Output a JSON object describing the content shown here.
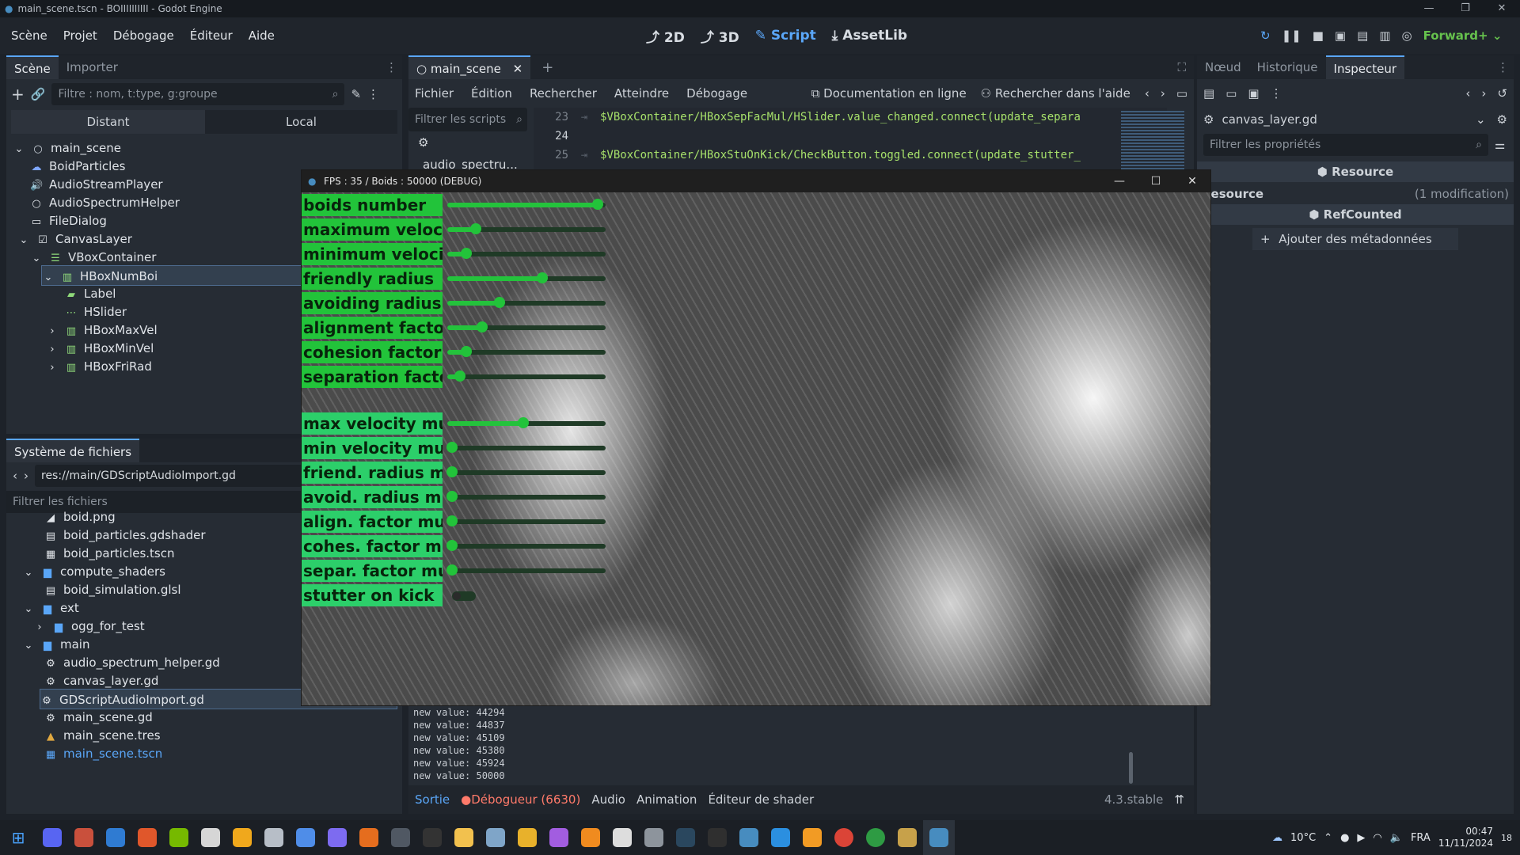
{
  "window": {
    "title": "main_scene.tscn - BOIIIIIIIIII - Godot Engine"
  },
  "menubar": {
    "items": [
      "Scène",
      "Projet",
      "Débogage",
      "Éditeur",
      "Aide"
    ],
    "main_tabs": [
      "2D",
      "3D",
      "Script",
      "AssetLib"
    ],
    "renderer": "Forward+"
  },
  "scene_dock": {
    "tabs": [
      "Scène",
      "Importer"
    ],
    "filter_placeholder": "Filtre : nom, t:type, g:groupe",
    "remote_label": "Distant",
    "local_label": "Local",
    "tree": [
      "main_scene",
      "BoidParticles",
      "AudioStreamPlayer",
      "AudioSpectrumHelper",
      "FileDialog",
      "CanvasLayer",
      "VBoxContainer",
      "HBoxNumBoi",
      "Label",
      "HSlider",
      "HBoxMaxVel",
      "HBoxMinVel",
      "HBoxFriRad"
    ]
  },
  "filesystem": {
    "title": "Système de fichiers",
    "path": "res://main/GDScriptAudioImport.gd",
    "filter_placeholder": "Filtrer les fichiers",
    "items": [
      "boid.png",
      "boid_particles.gdshader",
      "boid_particles.tscn",
      "compute_shaders",
      "boid_simulation.glsl",
      "ext",
      "ogg_for_test",
      "main",
      "audio_spectrum_helper.gd",
      "canvas_layer.gd",
      "GDScriptAudioImport.gd",
      "main_scene.gd",
      "main_scene.tres",
      "main_scene.tscn"
    ]
  },
  "script_editor": {
    "tab": "main_scene",
    "menu": [
      "Fichier",
      "Édition",
      "Rechercher",
      "Atteindre",
      "Débogage"
    ],
    "doc_online": "Documentation en ligne",
    "search_help": "Rechercher dans l'aide",
    "filter_scripts": "Filtrer les scripts",
    "script_list": [
      "audio_spectru..."
    ],
    "lines": [
      {
        "num": "23",
        "code": "$VBoxContainer/HBoxSepFacMul/HSlider.value_changed.connect(update_separa"
      },
      {
        "num": "24",
        "code": ""
      },
      {
        "num": "25",
        "code": "$VBoxContainer/HBoxStuOnKick/CheckButton.toggled.connect(update_stutter_"
      }
    ]
  },
  "console": {
    "lines": [
      "new value: 44294",
      "new value: 44837",
      "new value: 45109",
      "new value: 45380",
      "new value: 45924",
      "new value: 50000"
    ]
  },
  "bottom_tabs": {
    "output": "Sortie",
    "debugger": "Débogueur (6630)",
    "audio": "Audio",
    "animation": "Animation",
    "shader": "Éditeur de shader",
    "version": "4.3.stable"
  },
  "inspector": {
    "tabs": [
      "Nœud",
      "Historique",
      "Inspecteur"
    ],
    "resource_name": "canvas_layer.gd",
    "filter_placeholder": "Filtrer les propriétés",
    "section_resource": "Resource",
    "resource_label": "Resource",
    "modifications": "(1 modification)",
    "section_refcounted": "RefCounted",
    "add_metadata": "Ajouter des métadonnées"
  },
  "game_window": {
    "title": "FPS : 35 / Boids : 50000 (DEBUG)",
    "labels": [
      "boids number",
      "maximum velocity",
      "minimum velocity",
      "friendly radius",
      "avoiding radius",
      "alignment factor",
      "cohesion factor",
      "separation factor"
    ],
    "mult_labels": [
      "max velocity mult.",
      "min velocity mult.",
      "friend. radius mult",
      "avoid. radius mult.",
      "align. factor mult.",
      "cohes. factor mult.",
      "separ. factor mult.",
      "stutter on kick"
    ],
    "slider_levels": [
      0.95,
      0.18,
      0.12,
      0.6,
      0.33,
      0.22,
      0.12,
      0.08
    ],
    "mult_slider_levels": [
      0.48,
      0.03,
      0.03,
      0.03,
      0.03,
      0.03,
      0.03
    ],
    "stutter_on_kick": false
  },
  "taskbar": {
    "weather": "10°C",
    "lang": "FRA",
    "time": "00:47",
    "date": "11/11/2024",
    "badge": "18"
  }
}
